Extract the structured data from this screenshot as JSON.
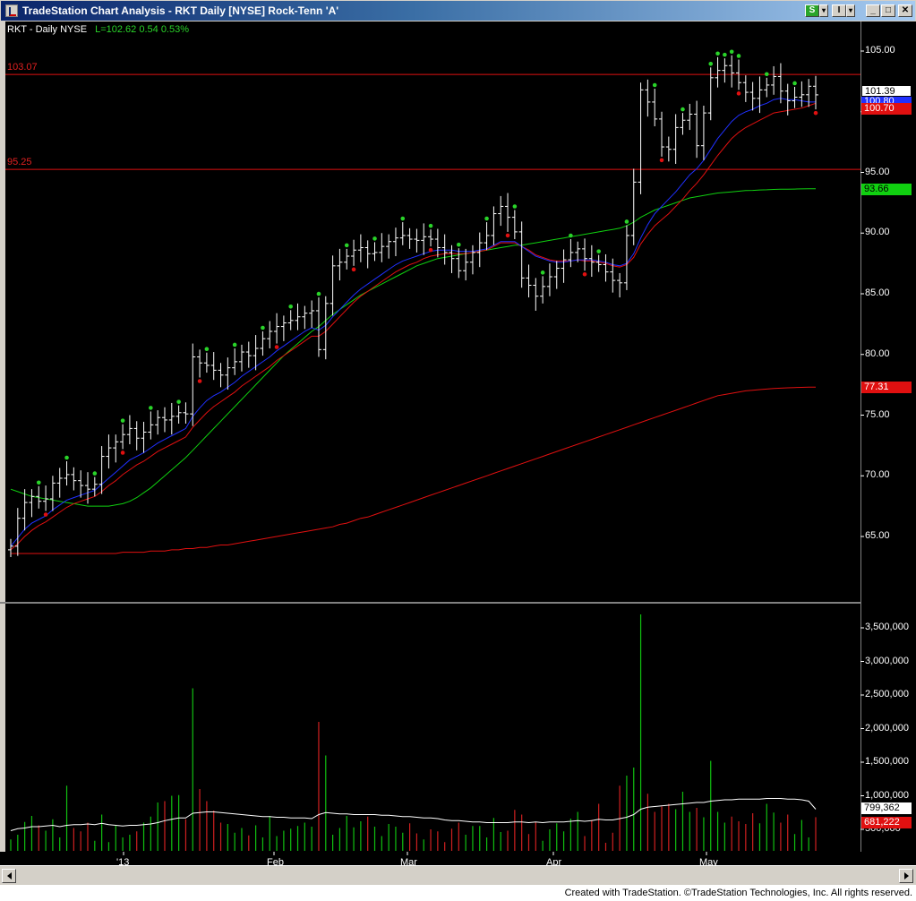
{
  "window": {
    "title": "TradeStation Chart Analysis - RKT Daily [NYSE] Rock-Tenn 'A'",
    "buttons": {
      "strategy": "S",
      "dropdown": "I",
      "dropdown_arrow": "▾",
      "minimize": "_",
      "restore": "□",
      "close": "✕"
    }
  },
  "legend": {
    "symbol": "RKT - Daily  NYSE",
    "last": "L=102.62  0.54  0.53%"
  },
  "hlines": [
    {
      "label": "103.07",
      "price": 103.07
    },
    {
      "label": "95.25",
      "price": 95.25
    }
  ],
  "price_axis": {
    "ticks": [
      "105.00",
      "100.00",
      "95.00",
      "90.00",
      "85.00",
      "80.00",
      "75.00",
      "70.00",
      "65.00"
    ]
  },
  "price_boxes": {
    "last": "101.39",
    "blue": "100.80",
    "red_short": "100.70",
    "green": "93.66",
    "red_long": "77.31"
  },
  "volume_axis": {
    "ticks": [
      "3,500,000",
      "3,000,000",
      "2,500,000",
      "2,000,000",
      "1,500,000",
      "1,000,000",
      "500,000"
    ]
  },
  "volume_boxes": {
    "avg": "799,362",
    "last": "681,222"
  },
  "date_axis": [
    "'13",
    "Feb",
    "Mar",
    "Apr",
    "May"
  ],
  "footer": "Created with TradeStation. ©TradeStation Technologies, Inc. All rights reserved.",
  "colors": {
    "bar": "#ffffff",
    "ma_fast": "#2030ff",
    "ma_mid": "#e01010",
    "ma_50": "#10d010",
    "ma_200": "#e01010",
    "up_vol": "#10c010",
    "down_vol": "#d02020",
    "vol_avg": "#ffffff"
  },
  "chart_data": {
    "type": "ohlc",
    "bars_close": [
      64.2,
      66.5,
      67.8,
      68.3,
      67.9,
      68.1,
      69.4,
      69.8,
      70.1,
      69.6,
      69.2,
      68.9,
      69.3,
      71.6,
      72.3,
      72.8,
      73.4,
      73.9,
      73.1,
      73.6,
      74.2,
      74.8,
      74.6,
      74.9,
      75.2,
      75.1,
      79.8,
      79.3,
      79.1,
      78.7,
      78.3,
      78.9,
      79.4,
      80.2,
      79.9,
      80.5,
      81.3,
      81.9,
      82.3,
      82.6,
      82.8,
      83.1,
      83.4,
      83.6,
      80.4,
      84.2,
      87.3,
      87.6,
      88.1,
      88.6,
      88.8,
      88.3,
      88.4,
      88.9,
      89.3,
      89.6,
      89.8,
      89.5,
      89.4,
      89.7,
      89.5,
      88.8,
      88.4,
      87.9,
      86.9,
      87.6,
      88.4,
      89.2,
      89.8,
      91.6,
      92.2,
      91.3,
      90.1,
      86.3,
      85.7,
      84.8,
      85.6,
      86.4,
      87.1,
      87.8,
      88.4,
      88.7,
      87.9,
      87.6,
      87.4,
      86.8,
      86.1,
      85.9,
      89.8,
      94.2,
      101.8,
      100.8,
      99.4,
      97.1,
      96.9,
      98.7,
      99.3,
      99.8,
      97.2,
      99.9,
      102.8,
      103.4,
      103.8,
      103.2,
      102.4,
      101.6,
      101.1,
      101.8,
      102.2,
      102.9,
      101.7,
      100.9,
      101.2,
      101.4,
      102.1,
      101.39
    ],
    "ma_fast": [
      64.2,
      64.9,
      65.6,
      66.1,
      66.4,
      66.7,
      67.2,
      67.6,
      68.0,
      68.2,
      68.4,
      68.6,
      68.8,
      69.3,
      69.8,
      70.3,
      70.8,
      71.3,
      71.6,
      71.9,
      72.3,
      72.7,
      73.0,
      73.3,
      73.6,
      73.9,
      74.9,
      75.6,
      76.2,
      76.6,
      76.9,
      77.3,
      77.7,
      78.2,
      78.6,
      79.0,
      79.4,
      79.8,
      80.3,
      80.7,
      81.1,
      81.5,
      81.9,
      82.2,
      82.0,
      82.4,
      83.1,
      83.7,
      84.3,
      84.9,
      85.4,
      85.8,
      86.2,
      86.6,
      87.0,
      87.4,
      87.7,
      87.9,
      88.1,
      88.3,
      88.5,
      88.6,
      88.6,
      88.6,
      88.5,
      88.5,
      88.5,
      88.6,
      88.7,
      89.0,
      89.3,
      89.3,
      89.3,
      88.9,
      88.5,
      88.1,
      87.9,
      87.7,
      87.6,
      87.6,
      87.7,
      87.8,
      87.8,
      87.8,
      87.7,
      87.6,
      87.4,
      87.3,
      87.5,
      88.3,
      89.6,
      90.7,
      91.6,
      92.2,
      92.8,
      93.4,
      94.1,
      94.8,
      95.3,
      96.0,
      96.9,
      97.8,
      98.5,
      99.2,
      99.7,
      100.0,
      100.2,
      100.5,
      100.7,
      101.0,
      101.1,
      101.0,
      101.0,
      100.9,
      100.8,
      100.8
    ],
    "ma_mid": [
      63.9,
      64.4,
      65.0,
      65.5,
      65.9,
      66.2,
      66.6,
      67.0,
      67.4,
      67.7,
      67.9,
      68.1,
      68.3,
      68.7,
      69.2,
      69.6,
      70.1,
      70.5,
      70.9,
      71.2,
      71.6,
      72.0,
      72.3,
      72.6,
      72.9,
      73.2,
      74.0,
      74.6,
      75.2,
      75.7,
      76.1,
      76.5,
      76.9,
      77.4,
      77.8,
      78.2,
      78.6,
      79.0,
      79.5,
      79.9,
      80.3,
      80.7,
      81.1,
      81.5,
      81.5,
      81.9,
      82.5,
      83.1,
      83.7,
      84.3,
      84.8,
      85.2,
      85.6,
      86.0,
      86.4,
      86.8,
      87.1,
      87.4,
      87.6,
      87.9,
      88.1,
      88.2,
      88.3,
      88.3,
      88.3,
      88.3,
      88.4,
      88.5,
      88.6,
      88.9,
      89.2,
      89.2,
      89.2,
      88.9,
      88.6,
      88.2,
      88.0,
      87.8,
      87.7,
      87.7,
      87.7,
      87.8,
      87.7,
      87.7,
      87.6,
      87.5,
      87.3,
      87.2,
      87.4,
      88.0,
      89.1,
      89.9,
      90.6,
      91.1,
      91.6,
      92.2,
      92.8,
      93.5,
      94.1,
      94.8,
      95.6,
      96.4,
      97.1,
      97.8,
      98.3,
      98.7,
      99.0,
      99.3,
      99.6,
      99.9,
      100.0,
      100.1,
      100.2,
      100.3,
      100.5,
      100.7
    ],
    "ma_50": [
      68.9,
      68.7,
      68.5,
      68.3,
      68.2,
      68.1,
      68.0,
      67.9,
      67.8,
      67.7,
      67.6,
      67.5,
      67.5,
      67.5,
      67.5,
      67.6,
      67.7,
      67.9,
      68.2,
      68.6,
      69.0,
      69.5,
      70.0,
      70.5,
      71.0,
      71.5,
      72.1,
      72.7,
      73.3,
      73.9,
      74.5,
      75.1,
      75.7,
      76.3,
      76.9,
      77.5,
      78.1,
      78.7,
      79.3,
      79.9,
      80.4,
      80.9,
      81.4,
      81.9,
      82.3,
      82.8,
      83.3,
      83.7,
      84.1,
      84.5,
      84.9,
      85.2,
      85.5,
      85.8,
      86.1,
      86.4,
      86.7,
      87.0,
      87.3,
      87.5,
      87.7,
      87.9,
      88.0,
      88.1,
      88.2,
      88.3,
      88.4,
      88.5,
      88.6,
      88.7,
      88.8,
      88.9,
      89.0,
      89.0,
      89.1,
      89.2,
      89.3,
      89.4,
      89.5,
      89.6,
      89.7,
      89.8,
      89.9,
      90.0,
      90.1,
      90.2,
      90.3,
      90.4,
      90.6,
      90.9,
      91.3,
      91.6,
      91.9,
      92.1,
      92.3,
      92.5,
      92.7,
      92.9,
      93.0,
      93.1,
      93.2,
      93.3,
      93.35,
      93.4,
      93.45,
      93.5,
      93.52,
      93.55,
      93.57,
      93.6,
      93.61,
      93.62,
      93.63,
      93.64,
      93.65,
      93.66
    ],
    "ma_200": [
      63.6,
      63.6,
      63.6,
      63.6,
      63.6,
      63.6,
      63.6,
      63.6,
      63.6,
      63.6,
      63.6,
      63.6,
      63.6,
      63.6,
      63.6,
      63.6,
      63.7,
      63.7,
      63.7,
      63.7,
      63.8,
      63.8,
      63.8,
      63.9,
      63.9,
      64.0,
      64.0,
      64.1,
      64.1,
      64.2,
      64.3,
      64.3,
      64.4,
      64.5,
      64.6,
      64.7,
      64.8,
      64.9,
      65.0,
      65.1,
      65.2,
      65.3,
      65.4,
      65.5,
      65.6,
      65.7,
      65.8,
      66.0,
      66.1,
      66.3,
      66.5,
      66.6,
      66.8,
      67.0,
      67.2,
      67.4,
      67.6,
      67.8,
      68.0,
      68.2,
      68.4,
      68.6,
      68.8,
      69.0,
      69.2,
      69.4,
      69.6,
      69.8,
      70.0,
      70.2,
      70.4,
      70.6,
      70.8,
      71.0,
      71.2,
      71.4,
      71.6,
      71.8,
      72.0,
      72.2,
      72.4,
      72.6,
      72.8,
      73.0,
      73.2,
      73.4,
      73.6,
      73.8,
      74.0,
      74.2,
      74.4,
      74.6,
      74.8,
      75.0,
      75.2,
      75.4,
      75.6,
      75.8,
      76.0,
      76.2,
      76.4,
      76.6,
      76.7,
      76.8,
      76.9,
      77.0,
      77.05,
      77.1,
      77.15,
      77.2,
      77.22,
      77.25,
      77.27,
      77.29,
      77.3,
      77.31
    ],
    "volume": [
      350000,
      420000,
      610000,
      700000,
      560000,
      480000,
      650000,
      380000,
      1150000,
      520000,
      470000,
      600000,
      330000,
      720000,
      310000,
      560000,
      380000,
      420000,
      470000,
      600000,
      690000,
      900000,
      920000,
      1000000,
      1010000,
      650000,
      2600000,
      1100000,
      920000,
      780000,
      600000,
      580000,
      450000,
      520000,
      410000,
      560000,
      380000,
      700000,
      400000,
      480000,
      510000,
      550000,
      600000,
      540000,
      2100000,
      1600000,
      420000,
      520000,
      700000,
      530000,
      620000,
      690000,
      540000,
      400000,
      580000,
      540000,
      450000,
      590000,
      440000,
      350000,
      500000,
      470000,
      310000,
      510000,
      600000,
      420000,
      550000,
      550000,
      380000,
      670000,
      460000,
      480000,
      790000,
      720000,
      430000,
      610000,
      330000,
      500000,
      590000,
      470000,
      660000,
      760000,
      400000,
      640000,
      880000,
      300000,
      450000,
      1150000,
      1300000,
      1420000,
      3700000,
      1030000,
      760000,
      840000,
      880000,
      800000,
      1060000,
      760000,
      820000,
      680000,
      1520000,
      760000,
      600000,
      690000,
      620000,
      580000,
      740000,
      590000,
      880000,
      750000,
      600000,
      720000,
      430000,
      640000,
      380000,
      681222
    ],
    "volume_avg": [
      480000,
      510000,
      520000,
      540000,
      540000,
      550000,
      560000,
      540000,
      560000,
      570000,
      570000,
      580000,
      570000,
      590000,
      570000,
      560000,
      550000,
      560000,
      560000,
      570000,
      580000,
      600000,
      630000,
      650000,
      670000,
      670000,
      740000,
      750000,
      760000,
      760000,
      750000,
      740000,
      730000,
      720000,
      710000,
      700000,
      690000,
      690000,
      680000,
      680000,
      670000,
      670000,
      670000,
      660000,
      720000,
      750000,
      740000,
      730000,
      730000,
      720000,
      720000,
      720000,
      720000,
      710000,
      710000,
      700000,
      690000,
      690000,
      680000,
      670000,
      670000,
      660000,
      640000,
      630000,
      630000,
      620000,
      610000,
      610000,
      600000,
      600000,
      600000,
      600000,
      610000,
      610000,
      600000,
      610000,
      600000,
      610000,
      610000,
      610000,
      620000,
      630000,
      620000,
      630000,
      650000,
      640000,
      640000,
      660000,
      680000,
      720000,
      800000,
      830000,
      840000,
      850000,
      860000,
      870000,
      880000,
      890000,
      900000,
      900000,
      920000,
      930000,
      940000,
      940000,
      950000,
      950000,
      950000,
      950000,
      960000,
      960000,
      960000,
      950000,
      950000,
      940000,
      920000,
      799362
    ],
    "highs_marked": [],
    "ylim_price": [
      60.5,
      106.2
    ],
    "ylim_volume": [
      0,
      3800000
    ]
  }
}
